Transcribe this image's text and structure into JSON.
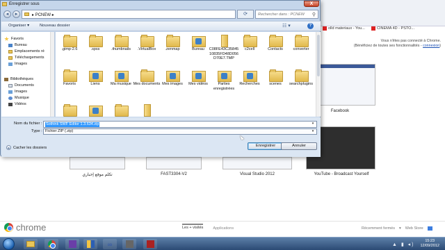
{
  "browser": {
    "bookmarks": [
      {
        "label": "olld materiaux - You..."
      },
      {
        "label": "CINEMA 4D - PSTO..."
      }
    ],
    "signin_note": "Vous n'êtes pas connecté à Chrome.",
    "signin_note2": "(Bénéficiez de toutes ses fonctionnalités -",
    "signin_link": "connexion",
    "thumbnails": [
      {
        "label": "Facebook"
      },
      {
        "label": "تكلم موقع إخباري"
      },
      {
        "label": "FAST3304-V2"
      },
      {
        "label": "Visual Studio 2012"
      },
      {
        "label": "YouTube - Broadcast Yourself"
      }
    ],
    "footer": {
      "logo_text": "chrome",
      "tabs": [
        "Les + visités",
        "Applications"
      ],
      "recent": "Récemment fermés",
      "store": "Web Store"
    }
  },
  "taskbar": {
    "time": "15:23",
    "date": "12/09/2012"
  },
  "dialog": {
    "title": "Enregistrer sous",
    "close_label": "X",
    "path": "PCNEW",
    "search_placeholder": "Rechercher dans : PCNEW",
    "organize": "Organiser ▾",
    "new_folder": "Nouveau dossier",
    "nav": {
      "favorites": "Favoris",
      "items": [
        {
          "label": "Bureau",
          "icon": "desktop-icon"
        },
        {
          "label": "Emplacements ré",
          "icon": "recent-places-icon"
        },
        {
          "label": "Téléchargements",
          "icon": "downloads-icon"
        },
        {
          "label": "Images",
          "icon": "images-icon"
        }
      ],
      "libraries": "Bibliothèques",
      "lib_items": [
        {
          "label": "Documents",
          "icon": "documents-icon"
        },
        {
          "label": "Images",
          "icon": "images-icon"
        },
        {
          "label": "Musique",
          "icon": "music-icon"
        },
        {
          "label": "Vidéos",
          "icon": "videos-icon"
        }
      ]
    },
    "files": [
      {
        "name": ".gimp-2.6",
        "icon": "folder"
      },
      {
        "name": ".spss",
        "icon": "folder"
      },
      {
        "name": ".thumbnails",
        "icon": "folder"
      },
      {
        "name": ".VirtualBox",
        "icon": "folder"
      },
      {
        "name": ".zenmap",
        "icon": "folder"
      },
      {
        "name": "Bureau",
        "icon": "special"
      },
      {
        "name": "C08FE43C3584510835FD48D056D70E7.TMP",
        "icon": "thin"
      },
      {
        "name": "c2cell",
        "icon": "folder"
      },
      {
        "name": "Contacts",
        "icon": "folder"
      },
      {
        "name": "converter",
        "icon": "folder"
      },
      {
        "name": "Favoris",
        "icon": "folder"
      },
      {
        "name": "Liens",
        "icon": "special"
      },
      {
        "name": "Ma musique",
        "icon": "special"
      },
      {
        "name": "Mes documents",
        "icon": "folder"
      },
      {
        "name": "Mes images",
        "icon": "special"
      },
      {
        "name": "Mes vidéos",
        "icon": "special"
      },
      {
        "name": "Parties enregistrées",
        "icon": "special"
      },
      {
        "name": "Recherches",
        "icon": "special"
      },
      {
        "name": "scenes",
        "icon": "folder"
      },
      {
        "name": "searchplugins",
        "icon": "folder"
      },
      {
        "name": "",
        "icon": "folder"
      },
      {
        "name": "",
        "icon": "special"
      },
      {
        "name": "",
        "icon": "folder"
      },
      {
        "name": "",
        "icon": "thin"
      }
    ],
    "filename_label": "Nom du fichier :",
    "filename_value": "Sothink SWF Editor 1.3.634.zip",
    "type_label": "Type :",
    "type_value": "Fichier ZIP (.zip)",
    "hide_folders": "Cacher les dossiers",
    "save": "Enregistrer",
    "cancel": "Annuler"
  }
}
